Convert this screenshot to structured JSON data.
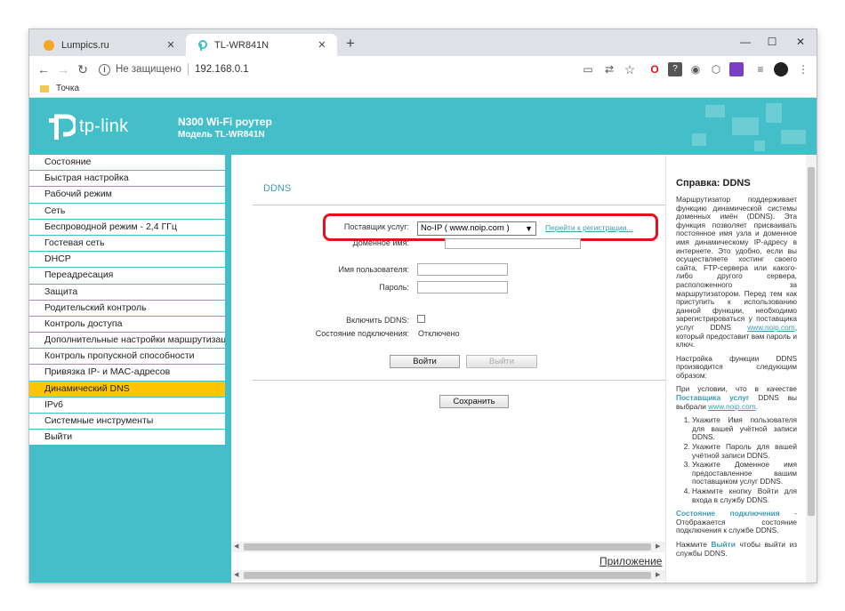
{
  "browser": {
    "tabs": [
      {
        "title": "Lumpics.ru",
        "close": "✕"
      },
      {
        "title": "TL-WR841N",
        "close": "✕"
      }
    ],
    "new_tab": "+",
    "window_controls": {
      "minimize": "—",
      "maximize": "☐",
      "close": "✕"
    },
    "nav": {
      "back": "←",
      "forward": "→",
      "reload": "↻"
    },
    "security": "Не защищено",
    "url": "192.168.0.1",
    "bookmark": "Точка"
  },
  "router": {
    "brand": "tp-link",
    "model_line1": "N300 Wi-Fi роутер",
    "model_line2": "Модель TL-WR841N",
    "menu": [
      "Состояние",
      "Быстрая настройка",
      "Рабочий режим",
      "Сеть",
      "Беспроводной режим - 2,4 ГГц",
      "Гостевая сеть",
      "DHCP",
      "Переадресация",
      "Защита",
      "Родительский контроль",
      "Контроль доступа",
      "Дополнительные настройки маршрутизации",
      "Контроль пропускной способности",
      "Привязка IP- и MAC-адресов",
      "Динамический DNS",
      "IPv6",
      "Системные инструменты",
      "Выйти"
    ],
    "active_menu": "Динамический DNS"
  },
  "ddns": {
    "title": "DDNS",
    "provider_label": "Поставщик услуг:",
    "provider_value": "No-IP ( www.noip.com )",
    "register_link": "Перейти к регистрации...",
    "domain_label": "Доменное имя:",
    "username_label": "Имя пользователя:",
    "password_label": "Пароль:",
    "enable_label": "Включить DDNS:",
    "status_label": "Состояние подключения:",
    "status_value": "Отключено",
    "login_button": "Войти",
    "logout_button": "Выйти",
    "save_button": "Сохранить",
    "appendix": "Приложение"
  },
  "help": {
    "title": "Справка: DDNS",
    "p1": "Маршрутизатор поддерживает функцию динамической системы доменных имён (DDNS). Эта функция позволяет присваивать постоянное имя узла и доменное имя динамическому IP-адресу в интернете. Это удобно, если вы осуществляете хостинг своего сайта, FTP-сервера или какого-либо другого сервера, расположенного за маршрутизатором. Перед тем как приступить к использованию данной функции, необходимо зарегистрироваться у поставщика услуг DDNS",
    "p1_link": "www.noip.com",
    "p1_tail": ", который предоставит вам пароль и ключ.",
    "p2": "Настройка функции DDNS производится следующим образом:",
    "p3_pre": "При условии, что в качестве",
    "p3_hl": "Поставщика услуг",
    "p3_mid": "DDNS вы выбрали",
    "p3_link": "www.noip.com",
    "p3_end": ".",
    "steps": [
      "Укажите Имя пользователя для вашей учётной записи DDNS.",
      "Укажите Пароль для вашей учётной записи DDNS.",
      "Укажите Доменное имя предоставленное вашим поставщиком услуг DDNS.",
      "Нажмите кнопку Войти для входа в службу DDNS."
    ],
    "p4_hl": "Состояние подключения",
    "p4": " - Отображается состояние подключения к службе DDNS.",
    "p5_pre": "Нажмите",
    "p5_hl": "Выйти",
    "p5": " чтобы выйти из службы DDNS."
  },
  "colors": {
    "teal": "#44bfc9",
    "active_menu": "#fec601",
    "highlight_box": "#e0151b",
    "link": "#3d9bb0"
  }
}
